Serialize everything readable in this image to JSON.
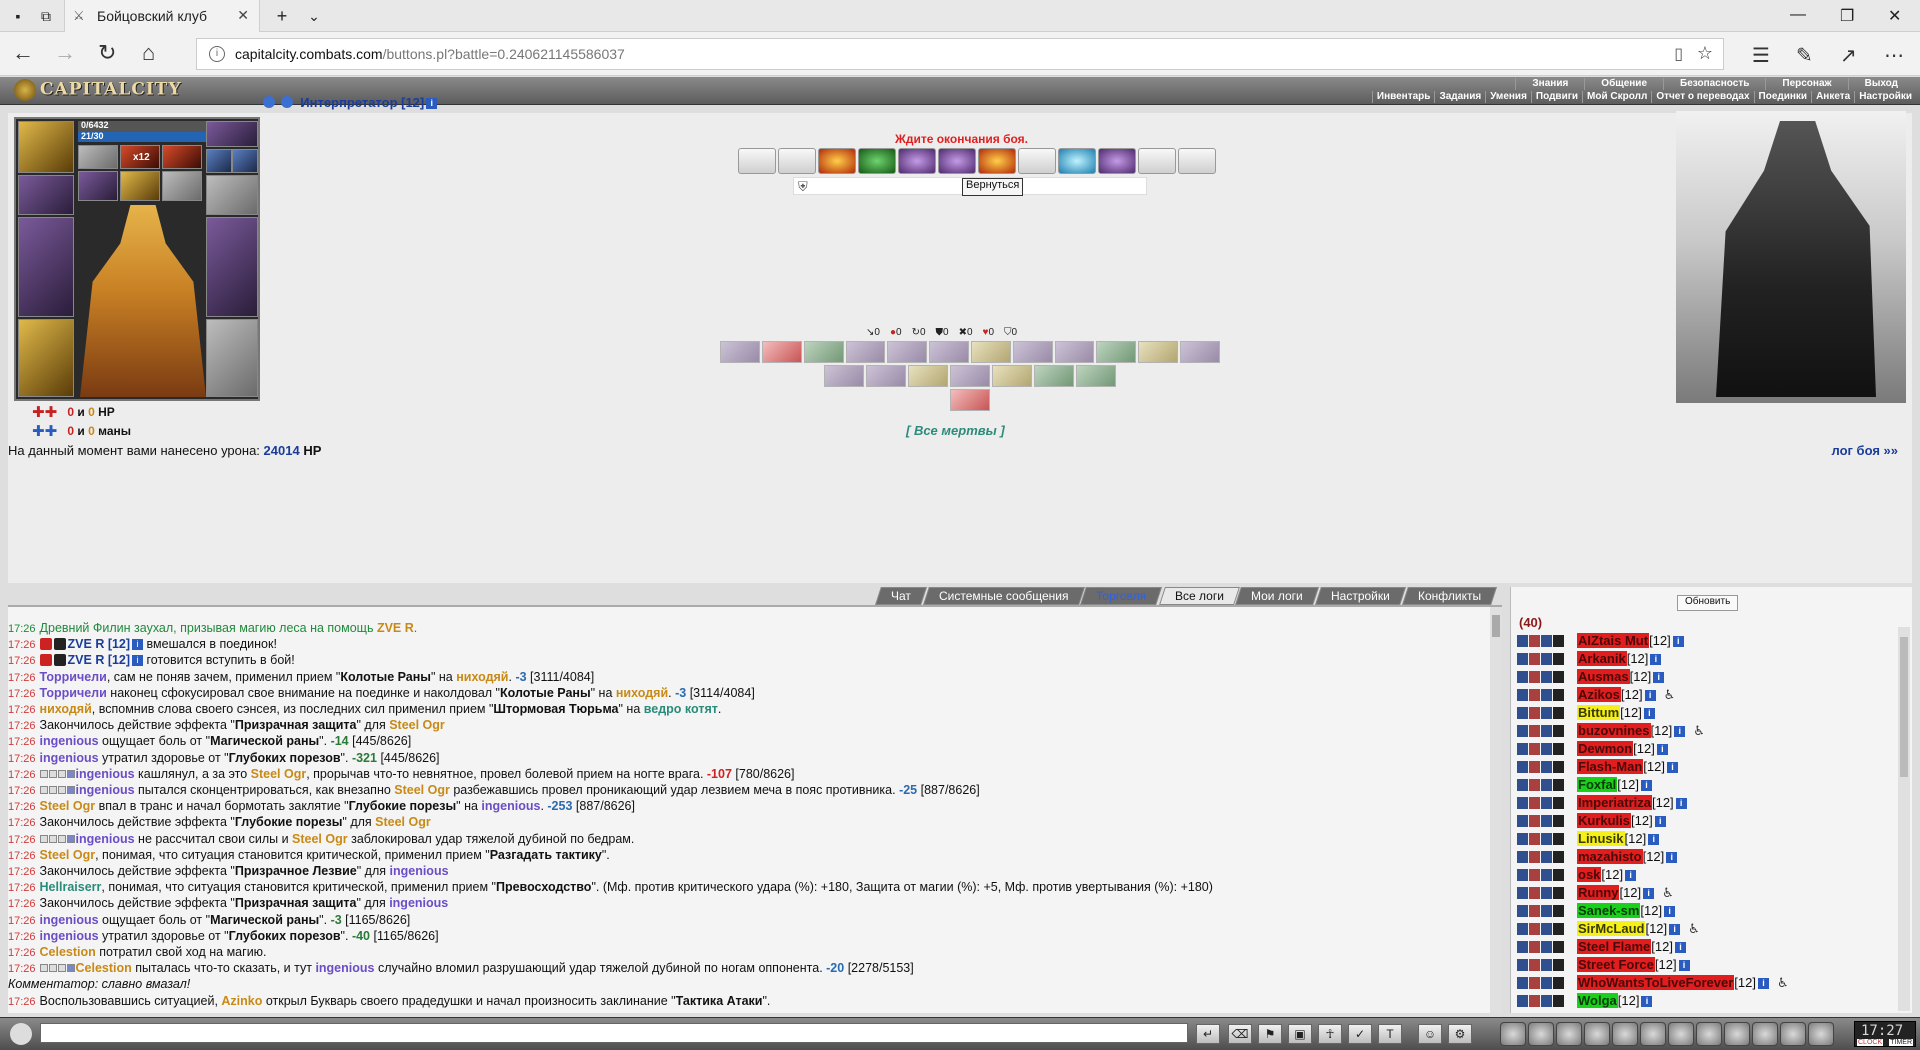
{
  "browser": {
    "tab_title": "Бойцовский клуб",
    "url_host": "capitalcity.combats.com",
    "url_path": "/buttons.pl?battle=0.240621145586037"
  },
  "game_menu": {
    "logo": "CAPITALCITY",
    "top": [
      "Знания",
      "Общение",
      "Безопасность",
      "Персонаж",
      "Выход"
    ],
    "bottom": [
      "Инвентарь",
      "Задания",
      "Умения",
      "Подвиги",
      "Мой Скролл",
      "Отчет о переводах",
      "Поединки",
      "Анкета",
      "Настройки"
    ]
  },
  "character": {
    "hp": "0/6432",
    "mana": "21/30",
    "hp_gain_a": "0",
    "hp_gain_b": "0",
    "hp_unit": "HP",
    "mana_gain_a": "0",
    "mana_gain_b": "0",
    "mana_unit": "маны",
    "and": "и",
    "slot_badge": "x12"
  },
  "battle": {
    "opponent": "Интерпретатор [12]",
    "wait_message": "Ждите окончания боя.",
    "back_button": "Вернуться",
    "counters": [
      "0",
      "0",
      "0",
      "0",
      "0",
      "0",
      "0"
    ],
    "all_dead": "[ Все мертвы ]",
    "damage_text": "На данный момент вами нанесено урона:",
    "damage_value": "24014",
    "damage_unit": "HP",
    "log_link": "лог боя »»"
  },
  "tabs": [
    "Чат",
    "Системные сообщения",
    "Торговля",
    "Все логи",
    "Мои логи",
    "Настройки",
    "Конфликты"
  ],
  "log": [
    {
      "t": "17:26",
      "parts": [
        [
          "g",
          "Древний Филин заухал, призывая магию леса на помощь "
        ],
        [
          "gold",
          "ZVE R"
        ],
        [
          "g",
          "."
        ]
      ],
      "green": true
    },
    {
      "t": "17:26",
      "parts": [
        [
          "icons",
          ""
        ],
        [
          "dark",
          "ZVE R [12]"
        ],
        [
          "i",
          ""
        ],
        [
          "",
          " вмешался в поединок!"
        ]
      ]
    },
    {
      "t": "17:26",
      "parts": [
        [
          "icons",
          ""
        ],
        [
          "dark",
          "ZVE R [12]"
        ],
        [
          "i",
          ""
        ],
        [
          "",
          " готовится вступить в бой!"
        ]
      ]
    },
    {
      "t": "17:26",
      "parts": [
        [
          "blue",
          "Торричели"
        ],
        [
          "",
          ", сам не поняв зачем, применил прием \""
        ],
        [
          "b",
          "Колотые Раны"
        ],
        [
          "",
          "\" на "
        ],
        [
          "gold",
          "ниходяй"
        ],
        [
          "",
          ". "
        ],
        [
          "mb",
          "-3"
        ],
        [
          "",
          " [3111/4084]"
        ]
      ]
    },
    {
      "t": "17:26",
      "parts": [
        [
          "blue",
          "Торричели"
        ],
        [
          "",
          " наконец сфокусировал свое внимание на поединке и наколдовал \""
        ],
        [
          "b",
          "Колотые Раны"
        ],
        [
          "",
          "\" на "
        ],
        [
          "gold",
          "ниходяй"
        ],
        [
          "",
          ". "
        ],
        [
          "mb",
          "-3"
        ],
        [
          "",
          " [3114/4084]"
        ]
      ]
    },
    {
      "t": "17:26",
      "parts": [
        [
          "gold",
          "ниходяй"
        ],
        [
          "",
          ", вспомнив слова своего сэнсея, из последних сил применил прием \""
        ],
        [
          "b",
          "Штормовая Тюрьма"
        ],
        [
          "",
          "\" на "
        ],
        [
          "teal",
          "ведро котят"
        ],
        [
          "",
          "."
        ]
      ]
    },
    {
      "t": "17:26",
      "parts": [
        [
          "",
          "Закончилось действие эффекта \""
        ],
        [
          "b",
          "Призрачная защита"
        ],
        [
          "",
          "\" для "
        ],
        [
          "gold",
          "Steel Ogr"
        ]
      ]
    },
    {
      "t": "17:26",
      "parts": [
        [
          "blue",
          "ingenious"
        ],
        [
          "",
          " ощущает боль от \""
        ],
        [
          "b",
          "Магической раны"
        ],
        [
          "",
          "\". "
        ],
        [
          "m",
          "-14"
        ],
        [
          "",
          " [445/8626]"
        ]
      ]
    },
    {
      "t": "17:26",
      "parts": [
        [
          "blue",
          "ingenious"
        ],
        [
          "",
          " утратил здоровье от \""
        ],
        [
          "b",
          "Глубоких порезов"
        ],
        [
          "",
          "\". "
        ],
        [
          "m",
          "-321"
        ],
        [
          "",
          " [445/8626]"
        ]
      ]
    },
    {
      "t": "17:26",
      "parts": [
        [
          "sq4",
          ""
        ],
        [
          "blue",
          "ingenious"
        ],
        [
          "",
          " кашлянул, а за это "
        ],
        [
          "gold",
          "Steel Ogr"
        ],
        [
          "",
          ", прорычав что-то невнятное, провел болевой прием на ногте врага. "
        ],
        [
          "mr",
          "-107"
        ],
        [
          "",
          " [780/8626]"
        ]
      ]
    },
    {
      "t": "17:26",
      "parts": [
        [
          "sq4",
          ""
        ],
        [
          "blue",
          "ingenious"
        ],
        [
          "",
          " пытался сконцентрироваться, как внезапно "
        ],
        [
          "gold",
          "Steel Ogr"
        ],
        [
          "",
          " разбежавшись провел проникающий удар лезвием меча в пояс противника. "
        ],
        [
          "mb",
          "-25"
        ],
        [
          "",
          " [887/8626]"
        ]
      ]
    },
    {
      "t": "17:26",
      "parts": [
        [
          "gold",
          "Steel Ogr"
        ],
        [
          "",
          " впал в транс и начал бормотать заклятие \""
        ],
        [
          "b",
          "Глубокие порезы"
        ],
        [
          "",
          "\" на "
        ],
        [
          "blue",
          "ingenious"
        ],
        [
          "",
          ". "
        ],
        [
          "mb",
          "-253"
        ],
        [
          "",
          " [887/8626]"
        ]
      ]
    },
    {
      "t": "17:26",
      "parts": [
        [
          "",
          "Закончилось действие эффекта \""
        ],
        [
          "b",
          "Глубокие порезы"
        ],
        [
          "",
          "\" для "
        ],
        [
          "gold",
          "Steel Ogr"
        ]
      ]
    },
    {
      "t": "17:26",
      "parts": [
        [
          "sq4",
          ""
        ],
        [
          "blue",
          "ingenious"
        ],
        [
          "",
          " не рассчитал свои силы и "
        ],
        [
          "gold",
          "Steel Ogr"
        ],
        [
          "",
          " заблокировал удар тяжелой дубиной по бедрам."
        ]
      ]
    },
    {
      "t": "17:26",
      "parts": [
        [
          "gold",
          "Steel Ogr"
        ],
        [
          "",
          ", понимая, что ситуация становится критической, применил прием \""
        ],
        [
          "b",
          "Разгадать тактику"
        ],
        [
          "",
          "\"."
        ]
      ]
    },
    {
      "t": "17:26",
      "parts": [
        [
          "",
          "Закончилось действие эффекта \""
        ],
        [
          "b",
          "Призрачное Лезвие"
        ],
        [
          "",
          "\" для "
        ],
        [
          "blue",
          "ingenious"
        ]
      ]
    },
    {
      "t": "17:26",
      "parts": [
        [
          "teal",
          "Hellraiserr"
        ],
        [
          "",
          ", понимая, что ситуация становится критической, применил прием \""
        ],
        [
          "b",
          "Превосходство"
        ],
        [
          "",
          "\". (Мф. против критического удара (%): +180, Защита от магии (%): +5, Мф. против увертывания (%): +180)"
        ]
      ]
    },
    {
      "t": "17:26",
      "parts": [
        [
          "",
          "Закончилось действие эффекта \""
        ],
        [
          "b",
          "Призрачная защита"
        ],
        [
          "",
          "\" для "
        ],
        [
          "blue",
          "ingenious"
        ]
      ]
    },
    {
      "t": "17:26",
      "parts": [
        [
          "blue",
          "ingenious"
        ],
        [
          "",
          " ощущает боль от \""
        ],
        [
          "b",
          "Магической раны"
        ],
        [
          "",
          "\". "
        ],
        [
          "m",
          "-3"
        ],
        [
          "",
          " [1165/8626]"
        ]
      ]
    },
    {
      "t": "17:26",
      "parts": [
        [
          "blue",
          "ingenious"
        ],
        [
          "",
          " утратил здоровье от \""
        ],
        [
          "b",
          "Глубоких порезов"
        ],
        [
          "",
          "\". "
        ],
        [
          "m",
          "-40"
        ],
        [
          "",
          " [1165/8626]"
        ]
      ]
    },
    {
      "t": "17:26",
      "parts": [
        [
          "gold",
          "Celestion"
        ],
        [
          "",
          " потратил свой ход на магию."
        ]
      ]
    },
    {
      "t": "17:26",
      "parts": [
        [
          "sq4",
          ""
        ],
        [
          "gold",
          "Celestion"
        ],
        [
          "",
          " пыталась что-то сказать, и тут "
        ],
        [
          "blue",
          "ingenious"
        ],
        [
          "",
          " случайно вломил разрушающий удар тяжелой дубиной по ногам оппонента. "
        ],
        [
          "mb",
          "-20"
        ],
        [
          "",
          " [2278/5153]"
        ]
      ]
    },
    {
      "t": "",
      "parts": [
        [
          "c",
          "Комментатор: славно вмазал!"
        ]
      ]
    },
    {
      "t": "17:26",
      "parts": [
        [
          "",
          "Воспользовавшись ситуацией, "
        ],
        [
          "gold",
          "Azinko"
        ],
        [
          "",
          " открыл Букварь своего прадедушки и начал произносить заклинание \""
        ],
        [
          "b",
          "Тактика Атаки"
        ],
        [
          "",
          "\"."
        ]
      ]
    }
  ],
  "players": {
    "refresh": "Обновить",
    "count": "(40)",
    "list": [
      {
        "name": "AIZtais Mut",
        "lvl": "[12]",
        "color": "red",
        "extra": ""
      },
      {
        "name": "Arkanik",
        "lvl": "[12]",
        "color": "red",
        "extra": ""
      },
      {
        "name": "Ausmas",
        "lvl": "[12]",
        "color": "red",
        "extra": ""
      },
      {
        "name": "Azikos",
        "lvl": "[12]",
        "color": "red",
        "extra": "♿"
      },
      {
        "name": "Bittum",
        "lvl": "[12]",
        "color": "yellow",
        "extra": ""
      },
      {
        "name": "buzovnines",
        "lvl": "[12]",
        "color": "red",
        "extra": "♿"
      },
      {
        "name": "Dewmon",
        "lvl": "[12]",
        "color": "red",
        "extra": ""
      },
      {
        "name": "Flash-Man",
        "lvl": "[12]",
        "color": "red",
        "extra": ""
      },
      {
        "name": "Foxfal",
        "lvl": "[12]",
        "color": "green",
        "extra": ""
      },
      {
        "name": "Imperiatriza",
        "lvl": "[12]",
        "color": "red",
        "extra": ""
      },
      {
        "name": "Kurkulis",
        "lvl": "[12]",
        "color": "red",
        "extra": ""
      },
      {
        "name": "Linusik",
        "lvl": "[12]",
        "color": "yellow",
        "extra": ""
      },
      {
        "name": "mazahisto",
        "lvl": "[12]",
        "color": "red",
        "extra": ""
      },
      {
        "name": "osk",
        "lvl": "[12]",
        "color": "red",
        "extra": ""
      },
      {
        "name": "Runny",
        "lvl": "[12]",
        "color": "red",
        "extra": "♿"
      },
      {
        "name": "Sanek-sm",
        "lvl": "[12]",
        "color": "green",
        "extra": ""
      },
      {
        "name": "SirMcLaud",
        "lvl": "[12]",
        "color": "yellow",
        "extra": "♿"
      },
      {
        "name": "Steel Flame",
        "lvl": "[12]",
        "color": "red",
        "extra": ""
      },
      {
        "name": "Street Force",
        "lvl": "[12]",
        "color": "red",
        "extra": ""
      },
      {
        "name": "WhoWantsToLiveForever",
        "lvl": "[12]",
        "color": "red",
        "extra": "♿"
      },
      {
        "name": "Wolga",
        "lvl": "[12]",
        "color": "green",
        "extra": ""
      }
    ]
  },
  "clock": {
    "time": "17:27",
    "label": "CLOCK",
    "label2": "TIMER"
  }
}
